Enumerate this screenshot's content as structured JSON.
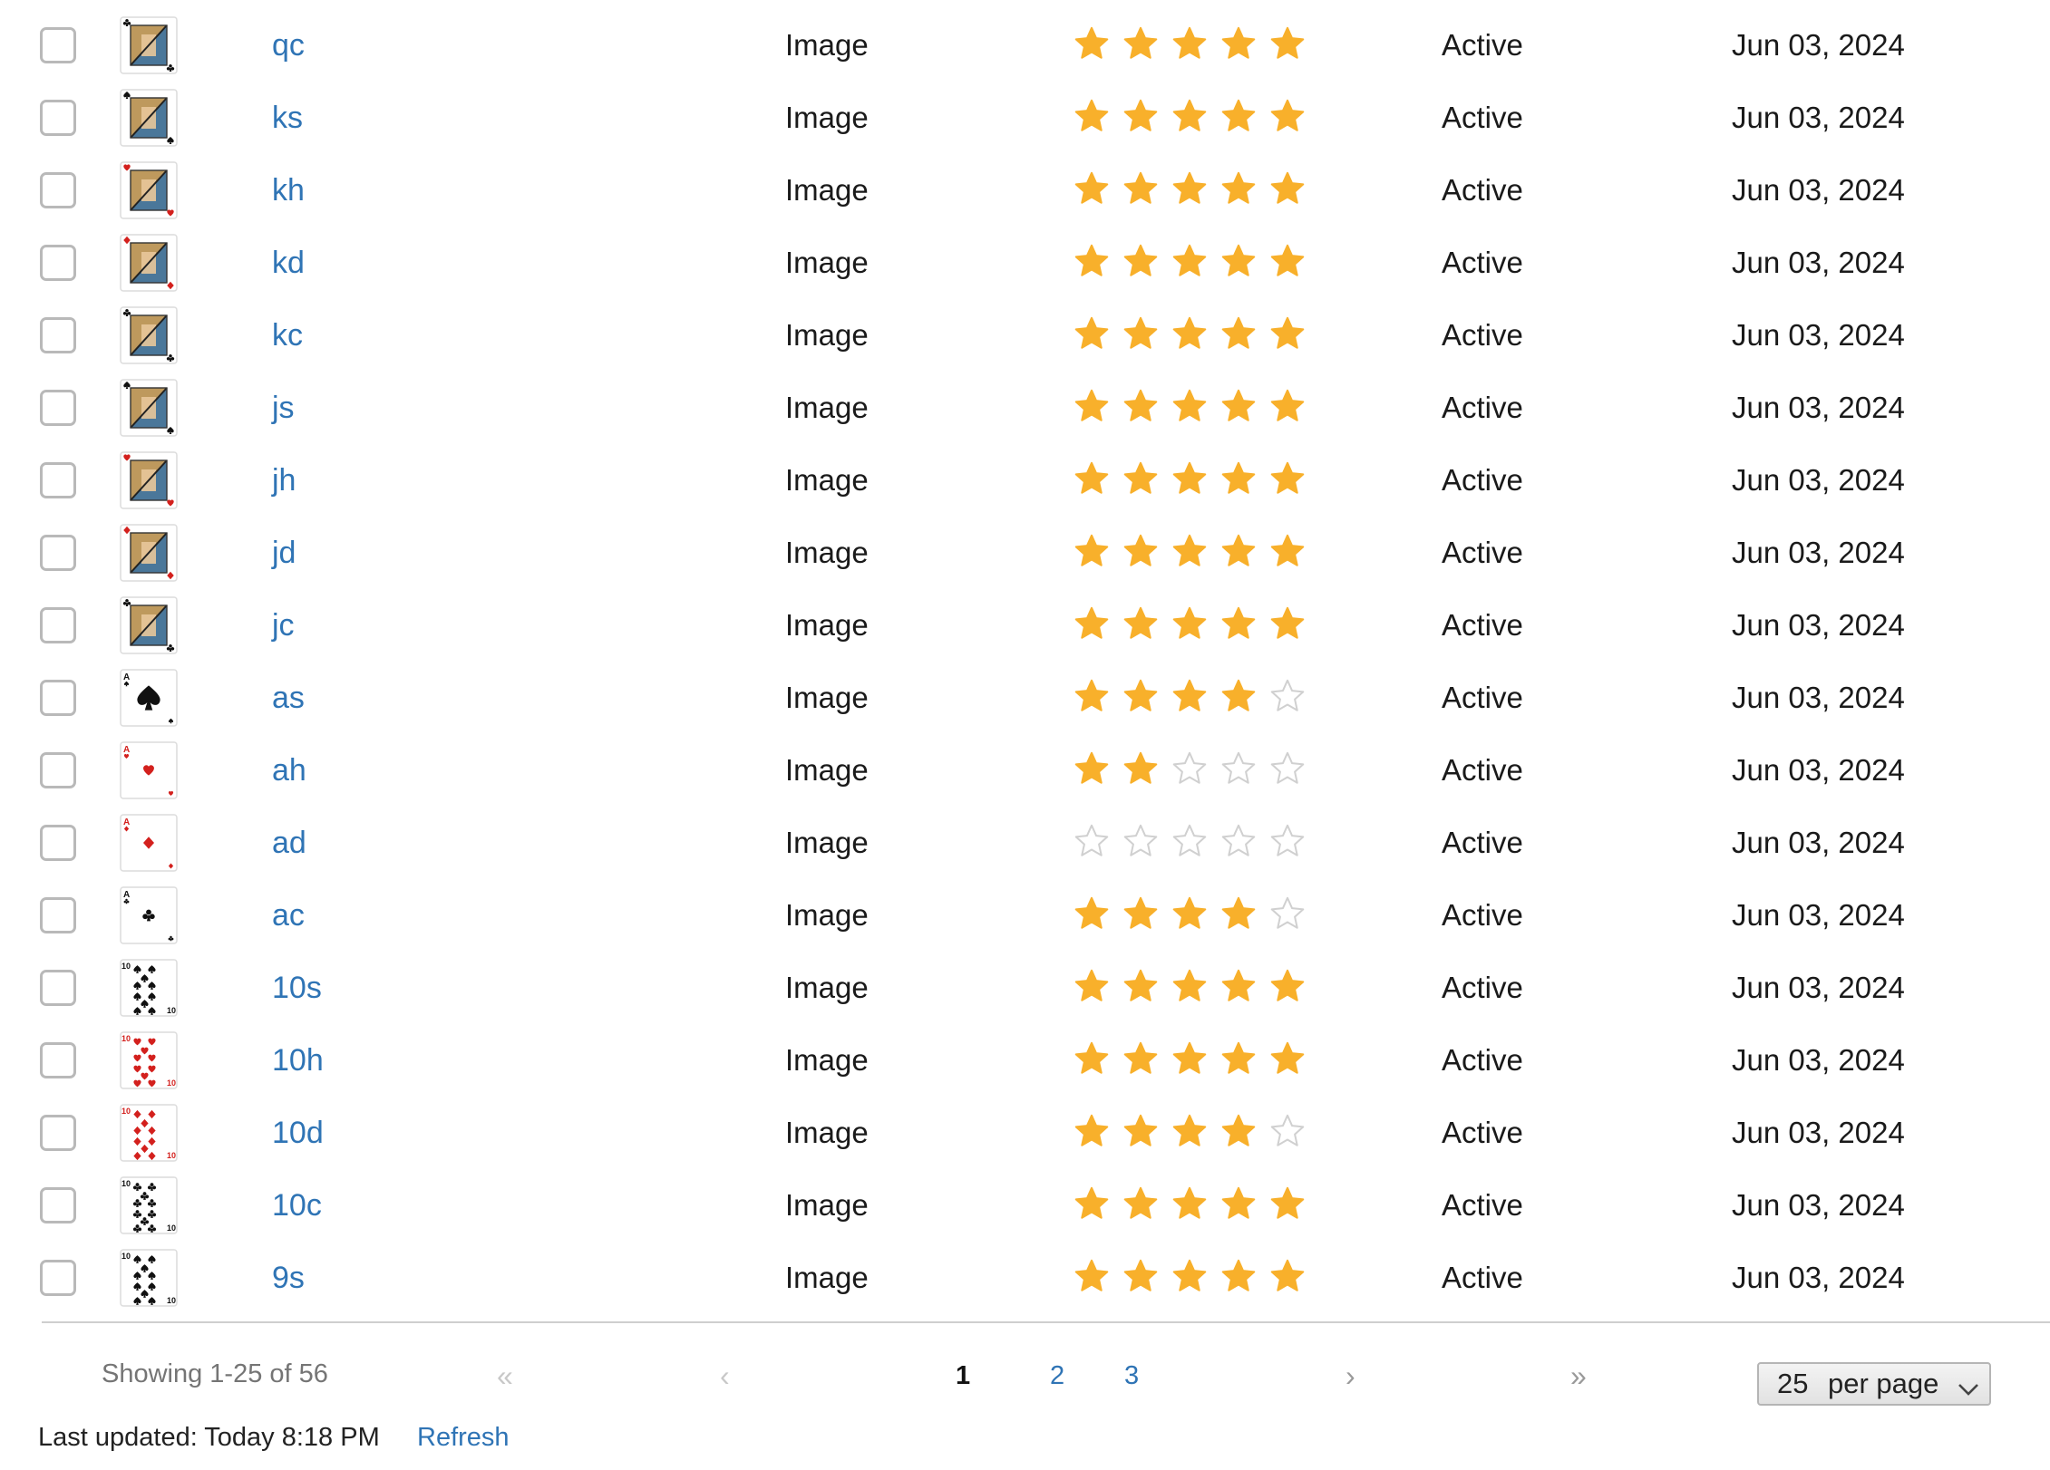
{
  "colors": {
    "link": "#2f74b5",
    "star_filled": "#f8b02b",
    "star_empty_border": "#d0d0d0",
    "red_suit": "#d3201d",
    "black_suit": "#111111"
  },
  "rows": [
    {
      "name": "qc",
      "type": "Image",
      "rating": 5,
      "status": "Active",
      "date": "Jun 03, 2024",
      "thumb": "face",
      "suit": "clubs"
    },
    {
      "name": "ks",
      "type": "Image",
      "rating": 5,
      "status": "Active",
      "date": "Jun 03, 2024",
      "thumb": "face",
      "suit": "spades"
    },
    {
      "name": "kh",
      "type": "Image",
      "rating": 5,
      "status": "Active",
      "date": "Jun 03, 2024",
      "thumb": "face",
      "suit": "hearts"
    },
    {
      "name": "kd",
      "type": "Image",
      "rating": 5,
      "status": "Active",
      "date": "Jun 03, 2024",
      "thumb": "face",
      "suit": "diamonds"
    },
    {
      "name": "kc",
      "type": "Image",
      "rating": 5,
      "status": "Active",
      "date": "Jun 03, 2024",
      "thumb": "face",
      "suit": "clubs"
    },
    {
      "name": "js",
      "type": "Image",
      "rating": 5,
      "status": "Active",
      "date": "Jun 03, 2024",
      "thumb": "face",
      "suit": "spades"
    },
    {
      "name": "jh",
      "type": "Image",
      "rating": 5,
      "status": "Active",
      "date": "Jun 03, 2024",
      "thumb": "face",
      "suit": "hearts"
    },
    {
      "name": "jd",
      "type": "Image",
      "rating": 5,
      "status": "Active",
      "date": "Jun 03, 2024",
      "thumb": "face",
      "suit": "diamonds"
    },
    {
      "name": "jc",
      "type": "Image",
      "rating": 5,
      "status": "Active",
      "date": "Jun 03, 2024",
      "thumb": "face",
      "suit": "clubs"
    },
    {
      "name": "as",
      "type": "Image",
      "rating": 4,
      "status": "Active",
      "date": "Jun 03, 2024",
      "thumb": "ace",
      "suit": "spades"
    },
    {
      "name": "ah",
      "type": "Image",
      "rating": 2,
      "status": "Active",
      "date": "Jun 03, 2024",
      "thumb": "ace",
      "suit": "hearts"
    },
    {
      "name": "ad",
      "type": "Image",
      "rating": 0,
      "status": "Active",
      "date": "Jun 03, 2024",
      "thumb": "ace",
      "suit": "diamonds"
    },
    {
      "name": "ac",
      "type": "Image",
      "rating": 4,
      "status": "Active",
      "date": "Jun 03, 2024",
      "thumb": "ace",
      "suit": "clubs"
    },
    {
      "name": "10s",
      "type": "Image",
      "rating": 5,
      "status": "Active",
      "date": "Jun 03, 2024",
      "thumb": "pips",
      "suit": "spades"
    },
    {
      "name": "10h",
      "type": "Image",
      "rating": 5,
      "status": "Active",
      "date": "Jun 03, 2024",
      "thumb": "pips",
      "suit": "hearts"
    },
    {
      "name": "10d",
      "type": "Image",
      "rating": 4,
      "status": "Active",
      "date": "Jun 03, 2024",
      "thumb": "pips",
      "suit": "diamonds"
    },
    {
      "name": "10c",
      "type": "Image",
      "rating": 5,
      "status": "Active",
      "date": "Jun 03, 2024",
      "thumb": "pips",
      "suit": "clubs"
    },
    {
      "name": "9s",
      "type": "Image",
      "rating": 5,
      "status": "Active",
      "date": "Jun 03, 2024",
      "thumb": "pips",
      "suit": "spades"
    }
  ],
  "footer": {
    "showing": "Showing 1-25 of 56",
    "first_icon": "double-chevron-left-icon",
    "prev_icon": "chevron-left-icon",
    "next_icon": "chevron-right-icon",
    "last_icon": "double-chevron-right-icon",
    "first_glyph": "«",
    "prev_glyph": "‹",
    "next_glyph": "›",
    "last_glyph": "»",
    "pages": [
      "1",
      "2",
      "3"
    ],
    "current_page": "1",
    "per_page_value": "25",
    "per_page_label": "per page",
    "last_updated": "Last updated: Today 8:18 PM",
    "refresh": "Refresh"
  }
}
